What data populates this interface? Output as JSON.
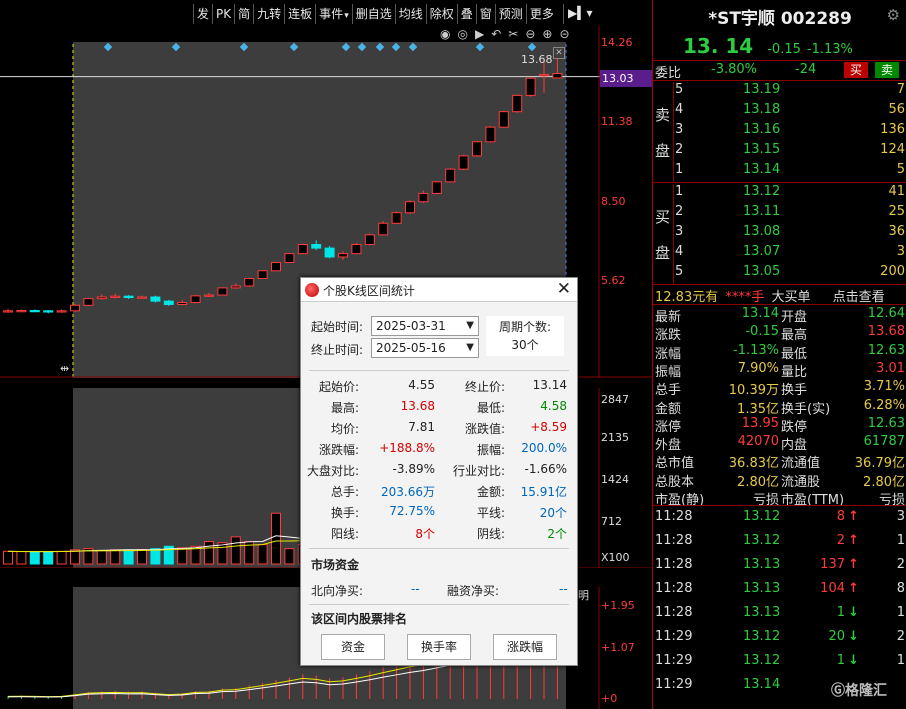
{
  "toolbar": [
    "发",
    "PK",
    "简",
    "九转",
    "连板",
    "事件",
    "删自选",
    "均线",
    "除权",
    "叠",
    "窗",
    "预测",
    "更多"
  ],
  "chart": {
    "y_labels": [
      "14.26",
      "13.03",
      "11.38",
      "8.50",
      "5.62"
    ],
    "peak_label": "13.68",
    "volume_labels": [
      "2847",
      "2135",
      "1424",
      "712",
      "X100"
    ],
    "indicator_labels": [
      "+1.95",
      "+1.07",
      "+0",
      "明"
    ],
    "colors": {
      "up": "#ff3b3b",
      "down": "#00e6e6",
      "ma5": "#ffffff",
      "ma10": "#e8e800",
      "highlight": "#3d3d3d",
      "marker": "#4ab4e6"
    }
  },
  "chart_data": {
    "type": "candlestick",
    "candles": [
      {
        "o": 4.55,
        "c": 4.55,
        "h": 4.62,
        "l": 4.48
      },
      {
        "o": 4.55,
        "c": 4.56,
        "h": 4.6,
        "l": 4.5
      },
      {
        "o": 4.56,
        "c": 4.55,
        "h": 4.6,
        "l": 4.5
      },
      {
        "o": 4.55,
        "c": 4.52,
        "h": 4.58,
        "l": 4.45
      },
      {
        "o": 4.52,
        "c": 4.55,
        "h": 4.6,
        "l": 4.48
      },
      {
        "o": 4.55,
        "c": 4.75,
        "h": 4.8,
        "l": 4.52
      },
      {
        "o": 4.75,
        "c": 4.99,
        "h": 5.02,
        "l": 4.72
      },
      {
        "o": 4.99,
        "c": 5.05,
        "h": 5.15,
        "l": 4.95
      },
      {
        "o": 5.05,
        "c": 5.08,
        "h": 5.18,
        "l": 5.0
      },
      {
        "o": 5.08,
        "c": 5.03,
        "h": 5.12,
        "l": 4.98
      },
      {
        "o": 5.03,
        "c": 5.05,
        "h": 5.1,
        "l": 4.98
      },
      {
        "o": 5.05,
        "c": 4.9,
        "h": 5.1,
        "l": 4.85
      },
      {
        "o": 4.9,
        "c": 4.78,
        "h": 4.95,
        "l": 4.73
      },
      {
        "o": 4.78,
        "c": 4.85,
        "h": 4.95,
        "l": 4.75
      },
      {
        "o": 4.85,
        "c": 5.09,
        "h": 5.12,
        "l": 4.82
      },
      {
        "o": 5.09,
        "c": 5.12,
        "h": 5.2,
        "l": 5.05
      },
      {
        "o": 5.12,
        "c": 5.38,
        "h": 5.4,
        "l": 5.1
      },
      {
        "o": 5.38,
        "c": 5.45,
        "h": 5.55,
        "l": 5.35
      },
      {
        "o": 5.45,
        "c": 5.72,
        "h": 5.75,
        "l": 5.42
      },
      {
        "o": 5.72,
        "c": 6.0,
        "h": 6.02,
        "l": 5.7
      },
      {
        "o": 6.0,
        "c": 6.3,
        "h": 6.32,
        "l": 5.98
      },
      {
        "o": 6.3,
        "c": 6.62,
        "h": 6.65,
        "l": 6.28
      },
      {
        "o": 6.62,
        "c": 6.95,
        "h": 6.98,
        "l": 6.6
      },
      {
        "o": 6.95,
        "c": 6.82,
        "h": 7.1,
        "l": 6.75
      },
      {
        "o": 6.82,
        "c": 6.5,
        "h": 6.9,
        "l": 6.45
      },
      {
        "o": 6.5,
        "c": 6.62,
        "h": 6.7,
        "l": 6.4
      },
      {
        "o": 6.62,
        "c": 6.95,
        "h": 7.0,
        "l": 6.6
      },
      {
        "o": 6.95,
        "c": 7.3,
        "h": 7.35,
        "l": 6.92
      },
      {
        "o": 7.3,
        "c": 7.72,
        "h": 7.8,
        "l": 7.28
      },
      {
        "o": 7.72,
        "c": 8.1,
        "h": 8.15,
        "l": 7.7
      },
      {
        "o": 8.1,
        "c": 8.5,
        "h": 8.55,
        "l": 8.05
      },
      {
        "o": 8.5,
        "c": 8.8,
        "h": 8.9,
        "l": 8.45
      },
      {
        "o": 8.8,
        "c": 9.22,
        "h": 9.25,
        "l": 8.78
      },
      {
        "o": 9.22,
        "c": 9.68,
        "h": 9.72,
        "l": 9.2
      },
      {
        "o": 9.68,
        "c": 10.16,
        "h": 10.2,
        "l": 9.65
      },
      {
        "o": 10.16,
        "c": 10.67,
        "h": 10.7,
        "l": 10.12
      },
      {
        "o": 10.67,
        "c": 11.2,
        "h": 11.24,
        "l": 10.65
      },
      {
        "o": 11.2,
        "c": 11.76,
        "h": 11.8,
        "l": 11.18
      },
      {
        "o": 11.76,
        "c": 12.35,
        "h": 12.38,
        "l": 11.72
      },
      {
        "o": 12.35,
        "c": 12.97,
        "h": 13.0,
        "l": 12.3
      },
      {
        "o": 13.1,
        "c": 13.1,
        "h": 13.68,
        "l": 12.45
      },
      {
        "o": 12.98,
        "c": 13.14,
        "h": 13.68,
        "l": 12.98
      }
    ],
    "volumes": [
      215,
      210,
      205,
      210,
      215,
      240,
      260,
      230,
      240,
      235,
      245,
      260,
      300,
      275,
      300,
      380,
      360,
      460,
      380,
      330,
      860,
      260,
      330,
      1340,
      365,
      330,
      330,
      740,
      580,
      700,
      1060,
      270,
      210,
      260,
      700,
      560,
      2280,
      1630,
      1040,
      1900,
      2000,
      1200
    ],
    "ylim": [
      4.0,
      14.5
    ],
    "vol_ylim": [
      0,
      2847
    ]
  },
  "stock": {
    "name": "*ST宇顺 002289",
    "price": "13. 14",
    "change": "-0.15",
    "pct": "-1.13%"
  },
  "weibi": {
    "label": "委比",
    "ratio": "-3.80%",
    "diff": "-24",
    "buy": "买",
    "sell": "卖"
  },
  "orderbook": {
    "sell_label": [
      "卖",
      "盘"
    ],
    "buy_label": [
      "买",
      "盘"
    ],
    "asks": [
      {
        "lv": "5",
        "pr": "13.19",
        "vl": "7"
      },
      {
        "lv": "4",
        "pr": "13.18",
        "vl": "56"
      },
      {
        "lv": "3",
        "pr": "13.16",
        "vl": "136"
      },
      {
        "lv": "2",
        "pr": "13.15",
        "vl": "124"
      },
      {
        "lv": "1",
        "pr": "13.14",
        "vl": "5"
      }
    ],
    "bids": [
      {
        "lv": "1",
        "pr": "13.12",
        "vl": "41"
      },
      {
        "lv": "2",
        "pr": "13.11",
        "vl": "25"
      },
      {
        "lv": "3",
        "pr": "13.08",
        "vl": "36"
      },
      {
        "lv": "4",
        "pr": "13.07",
        "vl": "3"
      },
      {
        "lv": "5",
        "pr": "13.05",
        "vl": "200"
      }
    ]
  },
  "summary": {
    "a": "12.83元有",
    "b": "****手",
    "c": "大买单",
    "d": "点击查看"
  },
  "stats": [
    {
      "l1": "最新",
      "v1": "13.14",
      "c1": "#2ecc40",
      "l2": "开盘",
      "v2": "12.64",
      "c2": "#2ecc40"
    },
    {
      "l1": "涨跌",
      "v1": "-0.15",
      "c1": "#2ecc40",
      "l2": "最高",
      "v2": "13.68",
      "c2": "#ff3b3b"
    },
    {
      "l1": "涨幅",
      "v1": "-1.13%",
      "c1": "#2ecc40",
      "l2": "最低",
      "v2": "12.63",
      "c2": "#2ecc40"
    },
    {
      "l1": "振幅",
      "v1": "7.90%",
      "c1": "#e6c94a",
      "l2": "量比",
      "v2": "3.01",
      "c2": "#ff3b3b"
    },
    {
      "l1": "总手",
      "v1": "10.39万",
      "c1": "#e6c94a",
      "l2": "换手",
      "v2": "3.71%",
      "c2": "#e6c94a"
    },
    {
      "l1": "金额",
      "v1": "1.35亿",
      "c1": "#e6c94a",
      "l2": "换手(实)",
      "v2": "6.28%",
      "c2": "#e6c94a"
    },
    {
      "l1": "涨停",
      "v1": "13.95",
      "c1": "#ff3b3b",
      "l2": "跌停",
      "v2": "12.63",
      "c2": "#2ecc40"
    },
    {
      "l1": "外盘",
      "v1": "42070",
      "c1": "#ff3b3b",
      "l2": "内盘",
      "v2": "61787",
      "c2": "#2ecc40"
    },
    {
      "l1": "总市值",
      "v1": "36.83亿",
      "c1": "#e6c94a",
      "l2": "流通值",
      "v2": "36.79亿",
      "c2": "#e6c94a"
    },
    {
      "l1": "总股本",
      "v1": "2.80亿",
      "c1": "#e6c94a",
      "l2": "流通股",
      "v2": "2.80亿",
      "c2": "#e6c94a"
    },
    {
      "l1": "市盈(静)",
      "v1": "亏损",
      "c1": "#ddd",
      "l2": "市盈(TTM)",
      "v2": "亏损",
      "c2": "#ddd"
    }
  ],
  "ticks": [
    {
      "t": "11:28",
      "p": "13.12",
      "v": "8",
      "a": "↑",
      "n": "3",
      "col": "#ff3b3b"
    },
    {
      "t": "11:28",
      "p": "13.12",
      "v": "2",
      "a": "↑",
      "n": "1",
      "col": "#ff3b3b"
    },
    {
      "t": "11:28",
      "p": "13.13",
      "v": "137",
      "a": "↑",
      "n": "2",
      "col": "#ff3b3b"
    },
    {
      "t": "11:28",
      "p": "13.13",
      "v": "104",
      "a": "↑",
      "n": "8",
      "col": "#ff3b3b"
    },
    {
      "t": "11:28",
      "p": "13.13",
      "v": "1",
      "a": "↓",
      "n": "1",
      "col": "#2ecc40"
    },
    {
      "t": "11:29",
      "p": "13.12",
      "v": "20",
      "a": "↓",
      "n": "2",
      "col": "#2ecc40"
    },
    {
      "t": "11:29",
      "p": "13.12",
      "v": "1",
      "a": "↓",
      "n": "1",
      "col": "#2ecc40"
    },
    {
      "t": "11:29",
      "p": "13.14",
      "v": "",
      "a": "",
      "n": "",
      "col": "#2ecc40"
    }
  ],
  "logo": "格隆汇",
  "dialog": {
    "title": "个股K线区间统计",
    "start_label": "起始时间:",
    "start_value": "2025-03-31",
    "end_label": "终止时间:",
    "end_value": "2025-05-16",
    "cycle_label": "周期个数:",
    "cycle_value": "30个",
    "rows": [
      {
        "l1": "起始价:",
        "v1": "4.55",
        "c1": "",
        "l2": "终止价:",
        "v2": "13.14",
        "c2": ""
      },
      {
        "l1": "最高:",
        "v1": "13.68",
        "c1": "red",
        "l2": "最低:",
        "v2": "4.58",
        "c2": "green"
      },
      {
        "l1": "均价:",
        "v1": "7.81",
        "c1": "",
        "l2": "涨跌值:",
        "v2": "+8.59",
        "c2": "red"
      },
      {
        "l1": "涨跌幅:",
        "v1": "+188.8%",
        "c1": "red",
        "l2": "振幅:",
        "v2": "200.0%",
        "c2": "blue"
      },
      {
        "l1": "大盘对比:",
        "v1": "-3.89%",
        "c1": "",
        "l2": "行业对比:",
        "v2": "-1.66%",
        "c2": ""
      },
      {
        "l1": "总手:",
        "v1": "203.66万",
        "c1": "blue",
        "l2": "金额:",
        "v2": "15.91亿",
        "c2": "blue"
      },
      {
        "l1": "换手:",
        "v1": "72.75%",
        "c1": "blue",
        "l2": "平线:",
        "v2": "20个",
        "c2": "blue"
      },
      {
        "l1": "阳线:",
        "v1": "8个",
        "c1": "red",
        "l2": "阴线:",
        "v2": "2个",
        "c2": "green"
      }
    ],
    "fund_title": "市场资金",
    "north_label": "北向净买:",
    "north_value": "--",
    "margin_label": "融资净买:",
    "margin_value": "--",
    "rank_title": "该区间内股票排名",
    "buttons": [
      "资金",
      "换手率",
      "涨跌幅"
    ]
  }
}
